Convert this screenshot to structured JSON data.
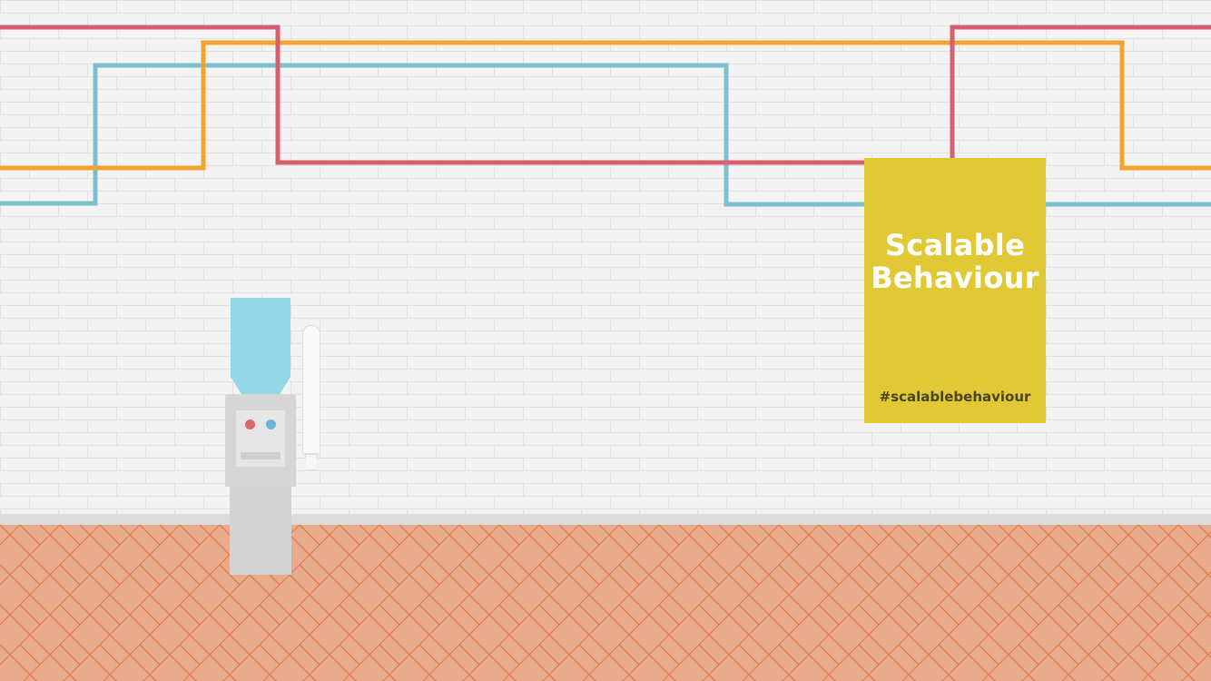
{
  "poster": {
    "title_line1": "Scalable",
    "title_line2": "Behaviour",
    "hashtag": "#scalablebehaviour"
  },
  "colors": {
    "wall": "#f3f3f3",
    "brick_line": "#e2e2e2",
    "baseboard": "#dcdcdc",
    "floor": "#e8ab8c",
    "floor_line": "#e07c4e",
    "pipe_red": "#d6606f",
    "pipe_orange": "#f2a431",
    "pipe_blue": "#7ebfcf",
    "poster_bg": "#e1c936",
    "poster_title": "#ffffff",
    "poster_tag": "#4a4520",
    "bottle": "#94d7e8"
  },
  "icons": {
    "water_cooler": "water-cooler-icon",
    "cup_dispenser": "cup-dispenser-icon"
  }
}
